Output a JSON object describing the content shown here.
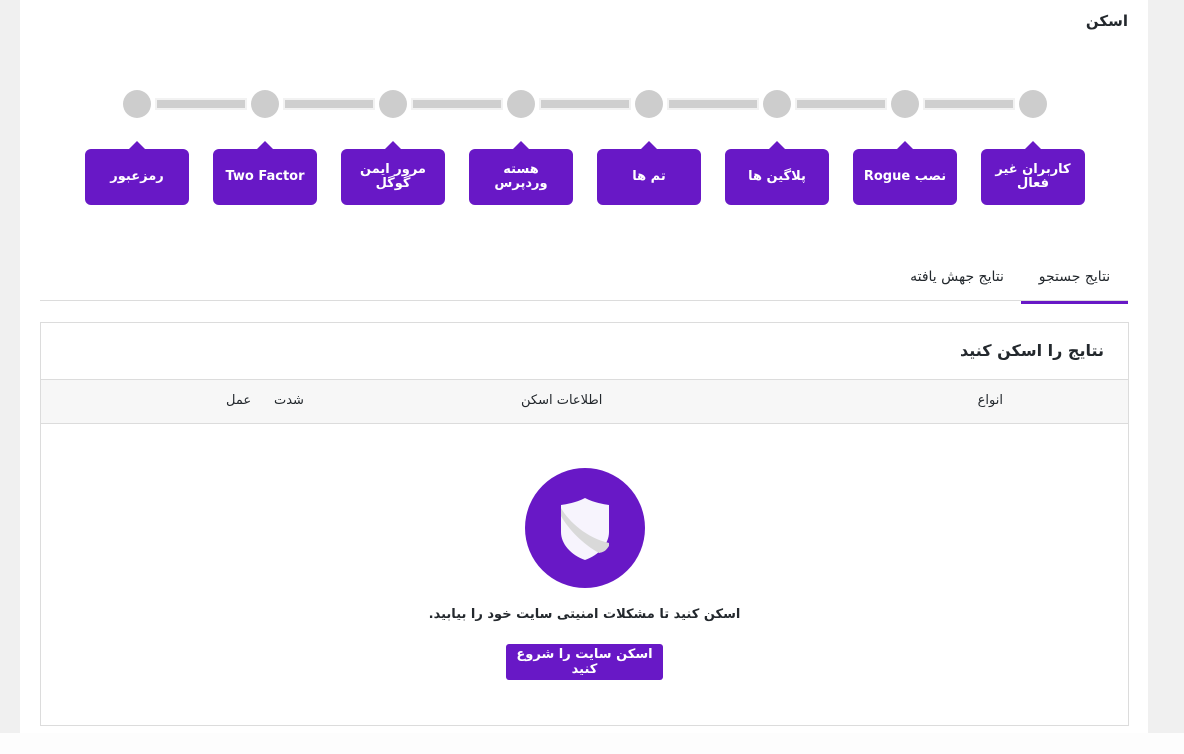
{
  "page": {
    "title": "اسکن"
  },
  "steps": [
    {
      "label": "کاربران غیر فعال"
    },
    {
      "label": "نصب Rogue"
    },
    {
      "label": "پلاگین ها"
    },
    {
      "label": "تم ها"
    },
    {
      "label": "هسته وردپرس"
    },
    {
      "label": "مرور ایمن گوگل"
    },
    {
      "label": "Two Factor"
    },
    {
      "label": "رمزعبور"
    }
  ],
  "tabs": [
    {
      "label": "نتایج جستجو",
      "active": true
    },
    {
      "label": "نتایج جهش یافته",
      "active": false
    }
  ],
  "results": {
    "title": "نتایج را اسکن کنید",
    "columns": {
      "types": "انواع",
      "info": "اطلاعات اسکن",
      "severity": "شدت",
      "action": "عمل"
    },
    "empty_message": "اسکن کنید تا مشکلات امنیتی سایت خود را بیابید.",
    "start_button": "اسکن سایت را شروع کنید",
    "icon": "shield-icon"
  },
  "colors": {
    "accent": "#6818c6",
    "step_inactive": "#cdcdcd"
  }
}
